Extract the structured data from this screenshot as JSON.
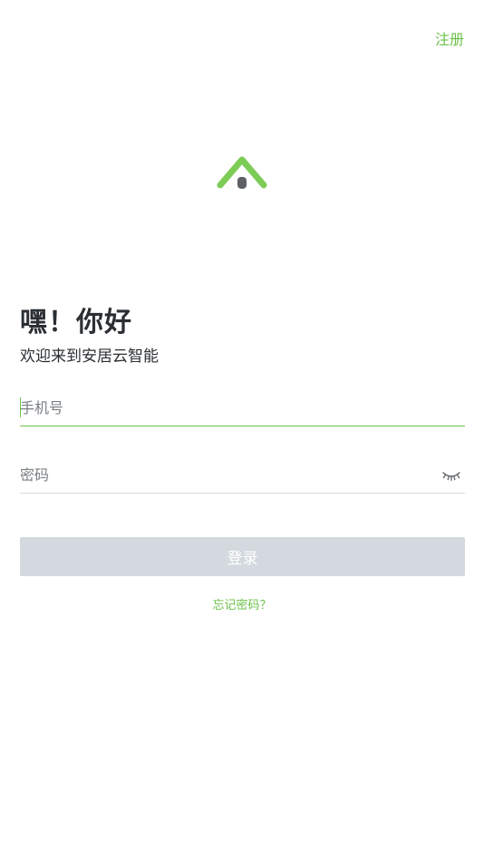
{
  "header": {
    "register_label": "注册"
  },
  "brand": {
    "logo_icon": "house-roof-logo-icon",
    "accent_color": "#6cc24a"
  },
  "welcome": {
    "title": "嘿！你好",
    "subtitle": "欢迎来到安居云智能"
  },
  "form": {
    "phone": {
      "placeholder": "手机号",
      "value": ""
    },
    "password": {
      "placeholder": "密码",
      "value": "",
      "toggle_icon": "eye-closed-icon"
    },
    "login_label": "登录",
    "forgot_label": "忘记密码？"
  }
}
